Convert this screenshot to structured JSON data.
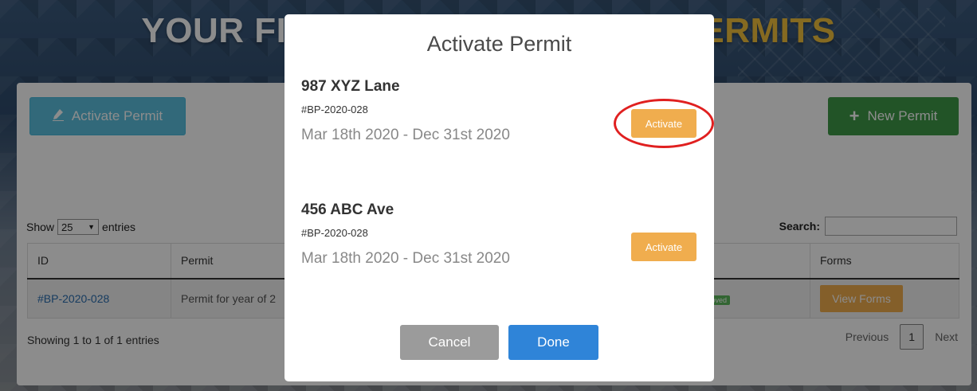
{
  "hero": {
    "title_left": "YOUR FI",
    "title_right": "ERMITS"
  },
  "toolbar": {
    "activate_permit_label": "Activate Permit",
    "new_permit_label": "New Permit"
  },
  "table_controls": {
    "show_label": "Show",
    "entries_value": "25",
    "entries_label": "entries",
    "search_label": "Search:",
    "search_value": ""
  },
  "table": {
    "headers": [
      "ID",
      "Permit",
      "",
      "Forms"
    ],
    "rows": [
      {
        "id": "#BP-2020-028",
        "permit": "Permit for year of 2",
        "status": "oved",
        "forms_button": "View Forms"
      }
    ]
  },
  "footer": {
    "showing_text": "Showing 1 to 1 of 1 entries",
    "previous_label": "Previous",
    "page": "1",
    "next_label": "Next"
  },
  "modal": {
    "title": "Activate Permit",
    "permits": [
      {
        "address": "987 XYZ Lane",
        "number": "#BP-2020-028",
        "dates": "Mar 18th 2020 - Dec 31st 2020",
        "action": "Activate"
      },
      {
        "address": "456 ABC Ave",
        "number": "#BP-2020-028",
        "dates": "Mar 18th 2020 - Dec 31st 2020",
        "action": "Activate"
      }
    ],
    "cancel_label": "Cancel",
    "done_label": "Done"
  },
  "colors": {
    "info": "#5bc0de",
    "success": "#3f9a47",
    "warning": "#f0ad4e",
    "primary": "#2f84d8",
    "highlight": "#e02020"
  }
}
